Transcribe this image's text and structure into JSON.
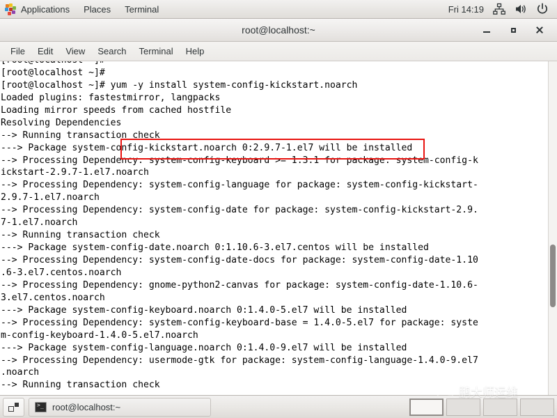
{
  "top_panel": {
    "apps_icon": "applications-starburst-icon",
    "menus": [
      {
        "label": "Applications",
        "name": "applications-menu"
      },
      {
        "label": "Places",
        "name": "places-menu"
      },
      {
        "label": "Terminal",
        "name": "terminal-menu"
      }
    ],
    "clock": "Fri 14:19",
    "tray": [
      {
        "name": "network-icon",
        "glyph": "network"
      },
      {
        "name": "volume-icon",
        "glyph": "speaker"
      },
      {
        "name": "power-icon",
        "glyph": "power"
      }
    ]
  },
  "window": {
    "title": "root@localhost:~",
    "buttons": {
      "minimize": "minimize-button",
      "maximize": "maximize-button",
      "close": "close-button"
    },
    "menubar": [
      {
        "label": "File",
        "name": "menu-file"
      },
      {
        "label": "Edit",
        "name": "menu-edit"
      },
      {
        "label": "View",
        "name": "menu-view"
      },
      {
        "label": "Search",
        "name": "menu-search"
      },
      {
        "label": "Terminal",
        "name": "menu-terminal"
      },
      {
        "label": "Help",
        "name": "menu-help"
      }
    ]
  },
  "terminal": {
    "highlight_color": "#e8120f",
    "highlighted_command": "yum -y install system-config-kickstart.noarch",
    "lines": [
      "[root@localhost ~]#",
      "[root@localhost ~]#",
      "[root@localhost ~]# yum -y install system-config-kickstart.noarch",
      "Loaded plugins: fastestmirror, langpacks",
      "Loading mirror speeds from cached hostfile",
      "Resolving Dependencies",
      "--> Running transaction check",
      "---> Package system-config-kickstart.noarch 0:2.9.7-1.el7 will be installed",
      "--> Processing Dependency: system-config-keyboard >= 1.3.1 for package: system-config-k",
      "ickstart-2.9.7-1.el7.noarch",
      "--> Processing Dependency: system-config-language for package: system-config-kickstart-",
      "2.9.7-1.el7.noarch",
      "--> Processing Dependency: system-config-date for package: system-config-kickstart-2.9.",
      "7-1.el7.noarch",
      "--> Running transaction check",
      "---> Package system-config-date.noarch 0:1.10.6-3.el7.centos will be installed",
      "--> Processing Dependency: system-config-date-docs for package: system-config-date-1.10",
      ".6-3.el7.centos.noarch",
      "--> Processing Dependency: gnome-python2-canvas for package: system-config-date-1.10.6-",
      "3.el7.centos.noarch",
      "---> Package system-config-keyboard.noarch 0:1.4.0-5.el7 will be installed",
      "--> Processing Dependency: system-config-keyboard-base = 1.4.0-5.el7 for package: syste",
      "m-config-keyboard-1.4.0-5.el7.noarch",
      "---> Package system-config-language.noarch 0:1.4.0-9.el7 will be installed",
      "--> Processing Dependency: usermode-gtk for package: system-config-language-1.4.0-9.el7",
      ".noarch",
      "--> Running transaction check"
    ],
    "scrollbar": "vertical-scrollbar"
  },
  "bottom_panel": {
    "show_desktop": "show-desktop-button",
    "tasks": [
      {
        "label": "root@localhost:~",
        "name": "taskbar-item-terminal",
        "icon": "terminal-icon"
      }
    ],
    "workspaces": [
      {
        "name": "workspace-1",
        "active": true
      },
      {
        "name": "workspace-2",
        "active": false
      },
      {
        "name": "workspace-3",
        "active": false
      },
      {
        "name": "workspace-4",
        "active": false
      }
    ]
  },
  "watermark": {
    "icon": "wechat-icon",
    "text": "鹏大师运维"
  }
}
